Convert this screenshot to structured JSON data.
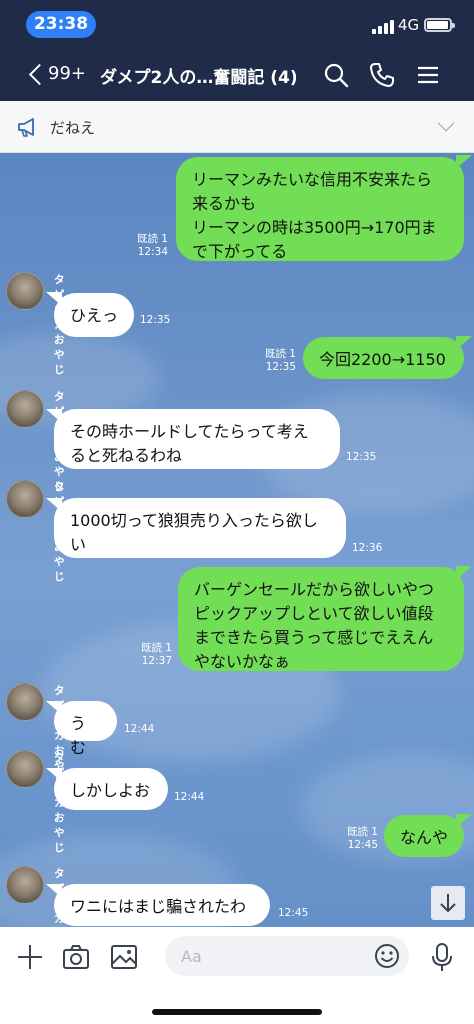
{
  "status_bar": {
    "time": "23:38",
    "network": "4G"
  },
  "header": {
    "back_count": "99+",
    "title": "ダメプ2人の…奮闘記 (4)",
    "icons": [
      "search-icon",
      "phone-icon",
      "menu-icon"
    ]
  },
  "announcement": {
    "text": "だねえ"
  },
  "messages": [
    {
      "dir": "out",
      "text": "リーマンみたいな信用不安来たら\n来るかも\nリーマンの時は3500円→170円ま\nで下がってる",
      "read": "既読 1",
      "time": "12:34"
    },
    {
      "dir": "in",
      "sender": "タピオカおやじ",
      "text": "ひえっ",
      "time": "12:35"
    },
    {
      "dir": "out",
      "text": "今回2200→1150",
      "read": "既読 1",
      "time": "12:35"
    },
    {
      "dir": "in",
      "sender": "タピオカおやじ",
      "text": "その時ホールドしてたらって考え\nると死ねるわね",
      "time": "12:35"
    },
    {
      "dir": "in",
      "sender": "タピオカおやじ",
      "text": "1000切って狼狽売り入ったら欲し\nい",
      "time": "12:36"
    },
    {
      "dir": "out",
      "text": "バーゲンセールだから欲しいやつ\nピックアップしといて欲しい値段\nまできたら買うって感じでええん\nやないかなぁ",
      "read": "既読 1",
      "time": "12:37"
    },
    {
      "dir": "in",
      "sender": "タピオカおやじ",
      "text": "うむ",
      "time": "12:44"
    },
    {
      "dir": "in",
      "sender": "タピオカおやじ",
      "text": "しかしよお",
      "time": "12:44"
    },
    {
      "dir": "out",
      "text": "なんや",
      "read": "既読 1",
      "time": "12:45"
    },
    {
      "dir": "in",
      "sender": "タピオカおやじ",
      "text": "ワニにはまじ騙されたわ",
      "time": "12:45"
    }
  ],
  "input": {
    "placeholder": "Aa"
  },
  "toolbar_icons": [
    "plus-icon",
    "camera-icon",
    "image-icon",
    "emoji-icon",
    "mic-icon"
  ]
}
